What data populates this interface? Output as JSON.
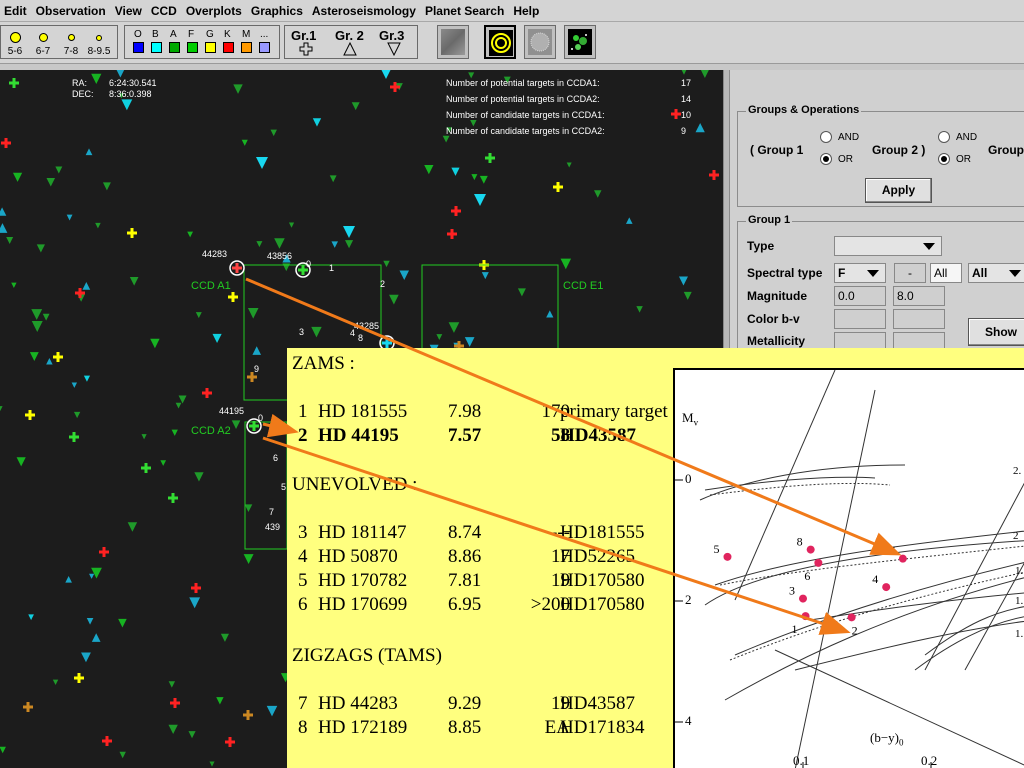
{
  "menubar": {
    "items": [
      "Edit",
      "Observation",
      "View",
      "CCD",
      "Overplots",
      "Graphics",
      "Asteroseismology",
      "Planet Search",
      "Help"
    ]
  },
  "toolbar": {
    "magnitudes": [
      "5-6",
      "6-7",
      "7-8",
      "8-9.5"
    ],
    "spectral_types": [
      {
        "label": "O",
        "color": "#0000ff"
      },
      {
        "label": "B",
        "color": "#00ffff"
      },
      {
        "label": "A",
        "color": "#00aa00"
      },
      {
        "label": "F",
        "color": "#00cc00"
      },
      {
        "label": "G",
        "color": "#ffff00"
      },
      {
        "label": "K",
        "color": "#ff0000"
      },
      {
        "label": "M",
        "color": "#ff9900"
      },
      {
        "label": "...",
        "color": "#9999ff"
      }
    ],
    "groups": [
      "Gr.1",
      "Gr. 2",
      "Gr.3"
    ],
    "group_icons": [
      "cross-icon",
      "triangle-up-icon",
      "triangle-down-icon"
    ],
    "buttons": [
      "sky-texture-icon",
      "target-rings-icon",
      "dotted-disk-icon",
      "star-cluster-icon"
    ]
  },
  "sky": {
    "ra_label": "RA:",
    "ra_value": "6:24:30.541",
    "dec_label": "DEC:",
    "dec_value": "8:36:0.398",
    "stats": [
      {
        "label": "Number of potential targets in CCDA1:",
        "value": "17"
      },
      {
        "label": "Number of potential targets in CCDA2:",
        "value": "14"
      },
      {
        "label": "Number of candidate targets in CCDA1:",
        "value": "10"
      },
      {
        "label": "Number of candidate targets in CCDA2:",
        "value": "9"
      }
    ],
    "ccd_labels": [
      "CCD A1",
      "CCD E1",
      "CCD A2"
    ],
    "star_ids": [
      "44283",
      "43856",
      "43285",
      "44195",
      "439"
    ],
    "numbers": [
      "1",
      "2",
      "3",
      "4",
      "5",
      "6",
      "7",
      "8",
      "9",
      "0",
      "0"
    ]
  },
  "panel": {
    "groups_ops": {
      "title": "Groups & Operations",
      "group1": "( Group 1",
      "group2": "Group 2 )",
      "group3": "Group",
      "and": "AND",
      "or": "OR",
      "apply": "Apply"
    },
    "group1": {
      "title": "Group 1",
      "type_label": "Type",
      "type_value": "",
      "spectral_label": "Spectral type",
      "spectral_value": "F",
      "spectral_dash": "-",
      "spectral_all": "All",
      "spectral_all2": "All",
      "magnitude_label": "Magnitude",
      "mag_min": "0.0",
      "mag_max": "8.0",
      "color_label": "Color b-v",
      "metallicity_label": "Metallicity",
      "show": "Show"
    }
  },
  "overlay": {
    "zams_heading": "ZAMS :",
    "unevolved_heading": "UNEVOLVED :",
    "zigzag_heading": "ZIGZAGS (TAMS)",
    "zams": [
      {
        "n": "1",
        "name": "HD 181555",
        "mag": "7.98",
        "v": "170",
        "note": "primary target"
      },
      {
        "n": "2",
        "name": "HD   44195",
        "mag": "7.57",
        "v": "58",
        "note": "HD43587"
      }
    ],
    "unevolved": [
      {
        "n": "3",
        "name": "HD 181147",
        "mag": "8.74",
        "v": "---",
        "note": "HD181555"
      },
      {
        "n": "4",
        "name": "HD  50870",
        "mag": "8.86",
        "v": "17",
        "note": "HD52265"
      },
      {
        "n": "5",
        "name": "HD 170782",
        "mag": "7.81",
        "v": "19",
        "note": "HD170580"
      },
      {
        "n": "6",
        "name": "HD 170699",
        "mag": "6.95",
        "v": ">200",
        "note": "HD170580"
      }
    ],
    "zigzag": [
      {
        "n": "7",
        "name": "HD    44283",
        "mag": "9.29",
        "v": "19",
        "note": "HD43587"
      },
      {
        "n": "8",
        "name": "HD  172189",
        "mag": "8.85",
        "v": "EA",
        "note": "HD171834"
      }
    ]
  },
  "hr_diagram": {
    "ylabel": "M",
    "ylabel_sub": "v",
    "xlabel": "(b−y)",
    "xlabel_sub": "0",
    "yticks": [
      "0",
      "2",
      "4"
    ],
    "xticks": [
      "0.1",
      "0.2"
    ],
    "points": [
      {
        "label": "1",
        "x": 0.102,
        "y": 2.25
      },
      {
        "label": "2",
        "x": 0.138,
        "y": 2.27
      },
      {
        "label": "3",
        "x": 0.1,
        "y": 1.96
      },
      {
        "label": "4",
        "x": 0.165,
        "y": 1.77
      },
      {
        "label": "5",
        "x": 0.041,
        "y": 1.27
      },
      {
        "label": "6",
        "x": 0.112,
        "y": 1.37
      },
      {
        "label": "7",
        "x": 0.178,
        "y": 1.3
      },
      {
        "label": "8",
        "x": 0.106,
        "y": 1.15
      }
    ],
    "point_color": "#e0245e",
    "right_labels": [
      "2.",
      "2",
      "1.",
      "1.",
      "1."
    ]
  },
  "colors": {
    "sky_bg": "#1c1c1c",
    "overlay_bg": "#ffff7f",
    "arrow": "#f07a1a",
    "ccd_green": "#22cc22"
  }
}
